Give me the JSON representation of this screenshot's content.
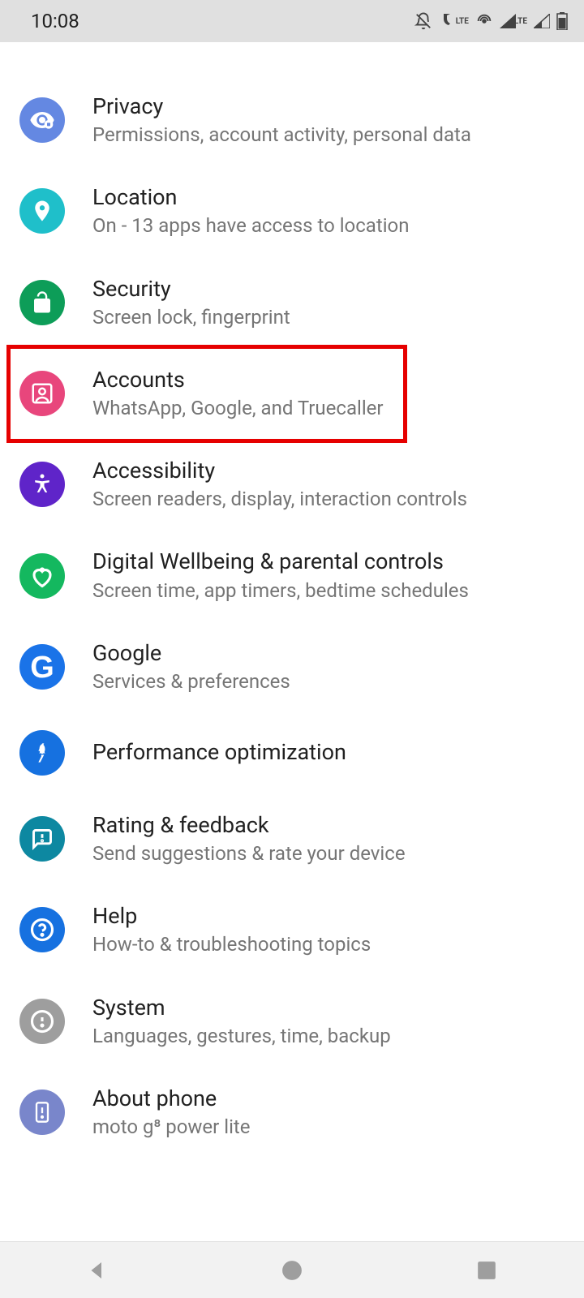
{
  "statusBar": {
    "time": "10:08",
    "lteLabel": "LTE"
  },
  "settings": {
    "items": [
      {
        "title": "Privacy",
        "subtitle": "Permissions, account activity, personal data",
        "color": "#6488e2"
      },
      {
        "title": "Location",
        "subtitle": "On - 13 apps have access to location",
        "color": "#1fbfca"
      },
      {
        "title": "Security",
        "subtitle": "Screen lock, fingerprint",
        "color": "#0d9d58"
      },
      {
        "title": "Accounts",
        "subtitle": "WhatsApp, Google, and Truecaller",
        "color": "#e8467c"
      },
      {
        "title": "Accessibility",
        "subtitle": "Screen readers, display, interaction controls",
        "color": "#5f24c9"
      },
      {
        "title": "Digital Wellbeing & parental controls",
        "subtitle": "Screen time, app timers, bedtime schedules",
        "color": "#14b85f"
      },
      {
        "title": "Google",
        "subtitle": "Services & preferences",
        "color": "#1a73e8"
      },
      {
        "title": "Performance optimization",
        "subtitle": "",
        "color": "#1671e0"
      },
      {
        "title": "Rating & feedback",
        "subtitle": "Send suggestions & rate your device",
        "color": "#0d88a1"
      },
      {
        "title": "Help",
        "subtitle": "How-to & troubleshooting topics",
        "color": "#1671e0"
      },
      {
        "title": "System",
        "subtitle": "Languages, gestures, time, backup",
        "color": "#9e9e9e"
      },
      {
        "title": "About phone",
        "subtitle": "moto g⁸ power lite",
        "color": "#7986cb"
      }
    ]
  },
  "highlightedIndex": 3
}
